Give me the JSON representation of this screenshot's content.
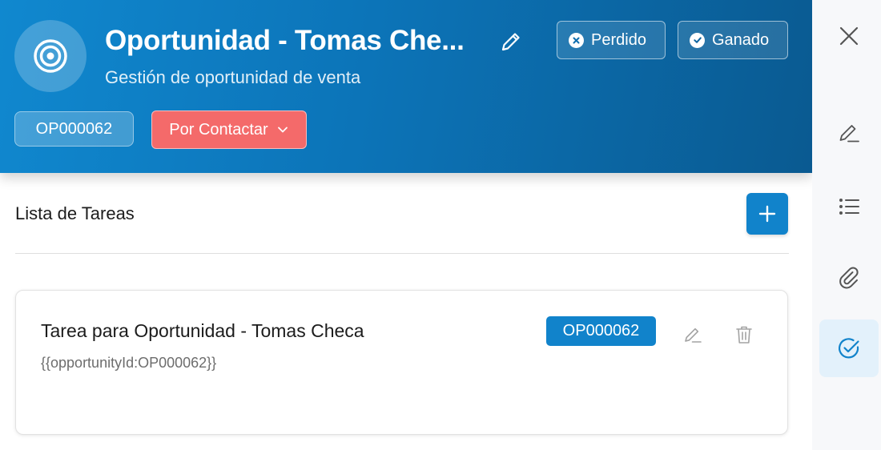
{
  "header": {
    "title": "Oportunidad - Tomas Che...",
    "subtitle": "Gestión de oportunidad de venta",
    "lost_label": "Perdido",
    "won_label": "Ganado",
    "code": "OP000062",
    "status": "Por Contactar"
  },
  "tasks_section": {
    "title": "Lista de Tareas"
  },
  "tasks": [
    {
      "title": "Tarea para Oportunidad - Tomas Checa",
      "description": "{{opportunityId:OP000062}}",
      "badge": "OP000062"
    }
  ],
  "rail": {
    "items": [
      "close-icon",
      "edit-icon",
      "list-icon",
      "paperclip-icon",
      "check-circle-icon"
    ],
    "active": "check-circle-icon"
  },
  "colors": {
    "header_start": "#1088cf",
    "header_end": "#0a5a91",
    "status_red": "#f46a6a",
    "accent_blue": "#1183cb",
    "rail_active_bg": "#e3f1fb"
  }
}
